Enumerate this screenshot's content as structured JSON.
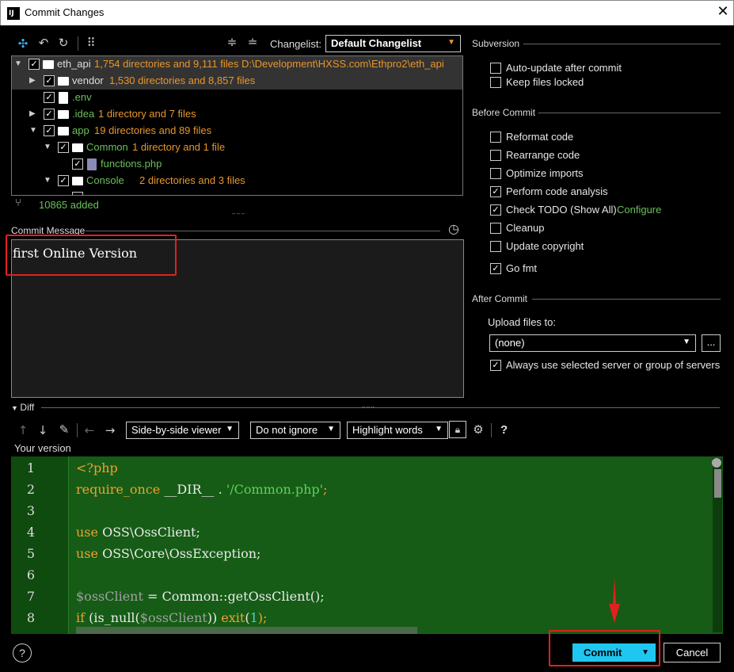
{
  "window": {
    "title": "Commit Changes",
    "close_glyph": "✕",
    "logo_text": "IJ"
  },
  "toolbar": {
    "changelist_label": "Changelist:",
    "changelist_value": "Default Changelist"
  },
  "tree": {
    "rows": [
      {
        "name": "eth_api",
        "info": "1,754 directories and 9,111 files  D:\\Development\\HXSS.com\\Ethpro2\\eth_api"
      },
      {
        "name": "vendor",
        "info": "1,530 directories and 8,857 files"
      },
      {
        "name": ".env",
        "info": ""
      },
      {
        "name": ".idea",
        "info": "1 directory and 7 files"
      },
      {
        "name": "app",
        "info": "19 directories and 89 files"
      },
      {
        "name": "Common",
        "info": "1 directory and 1 file"
      },
      {
        "name": "functions.php",
        "info": ""
      },
      {
        "name": "Console",
        "info": "2 directories and 3 files"
      }
    ],
    "added_status": "10865 added"
  },
  "commit_message": {
    "label": "Commit Message",
    "text": "first Online Version"
  },
  "diff": {
    "label": "Diff",
    "viewer": "Side-by-side viewer",
    "whitespace": "Do not ignore",
    "highlight": "Highlight words",
    "help": "?",
    "your_version": "Your version",
    "line_numbers": [
      "1",
      "2",
      "3",
      "4",
      "5",
      "6",
      "7",
      "8"
    ],
    "lines": {
      "l1": "<?php",
      "l2a": "require_once",
      "l2b": " __DIR__ . ",
      "l2c": "'/Common.php'",
      "l2d": ";",
      "l4a": "use",
      "l4b": " OSS\\OssClient;",
      "l5a": "use",
      "l5b": " OSS\\Core\\OssException;",
      "l7a": "$ossClient",
      "l7b": " = Common::getOssClient();",
      "l8a": "if",
      "l8b": " (is_null(",
      "l8c": "$ossClient",
      "l8d": ")) ",
      "l8e": "exit",
      "l8f": "(",
      "l8g": "1",
      "l8h": ");"
    }
  },
  "subversion": {
    "section": "Subversion",
    "auto_update": "Auto-update after commit",
    "keep_locked": "Keep files locked"
  },
  "before_commit": {
    "section": "Before Commit",
    "options": [
      {
        "label": "Reformat code",
        "checked": false
      },
      {
        "label": "Rearrange code",
        "checked": false
      },
      {
        "label": "Optimize imports",
        "checked": false
      },
      {
        "label": "Perform code analysis",
        "checked": true
      },
      {
        "label": "Check TODO (Show All)",
        "checked": true
      },
      {
        "label": "Cleanup",
        "checked": false
      },
      {
        "label": "Update copyright",
        "checked": false
      },
      {
        "label": "Go fmt",
        "checked": true
      }
    ],
    "configure_link": "Configure"
  },
  "after_commit": {
    "section": "After Commit",
    "upload_label": "Upload files to:",
    "upload_value": "(none)",
    "browse": "...",
    "always_use": "Always use selected server or group of servers"
  },
  "footer": {
    "help": "?",
    "commit": "Commit",
    "cancel": "Cancel"
  },
  "colors": {
    "accent_commit": "#1fc7f0",
    "highlight_red": "#e0211f",
    "diff_bg": "#165c16",
    "orange_info": "#e8962b",
    "green_info": "#6ac05a"
  }
}
